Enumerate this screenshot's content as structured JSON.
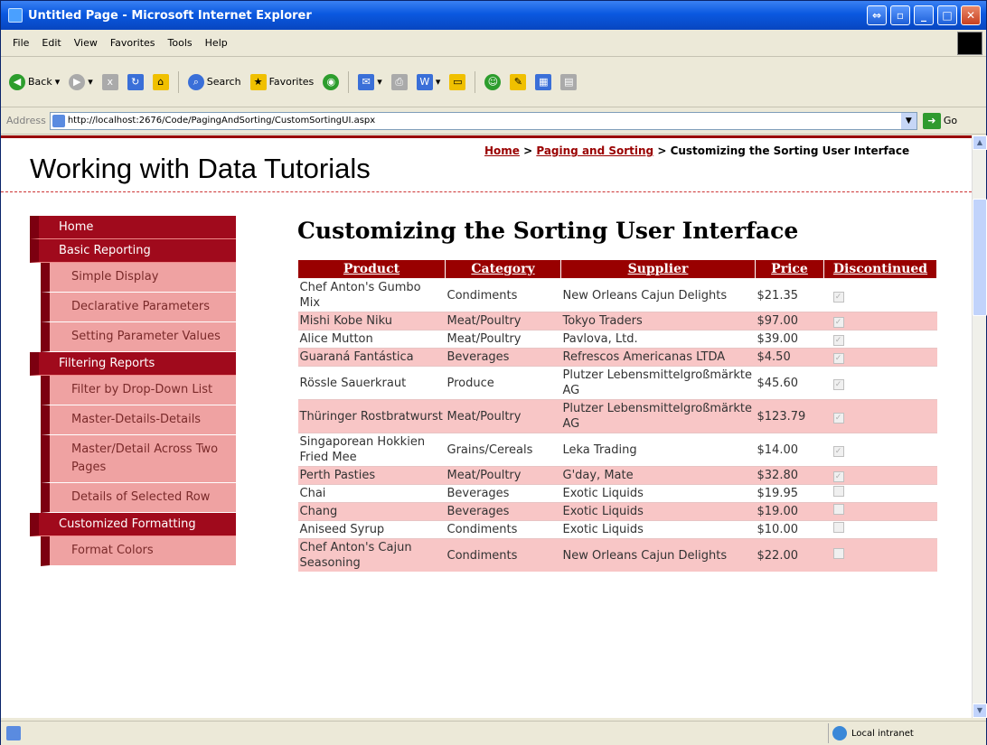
{
  "window": {
    "title": "Untitled Page - Microsoft Internet Explorer"
  },
  "menu": [
    "File",
    "Edit",
    "View",
    "Favorites",
    "Tools",
    "Help"
  ],
  "toolbar": {
    "back": "Back",
    "search": "Search",
    "favorites": "Favorites"
  },
  "address": {
    "label": "Address",
    "url": "http://localhost:2676/Code/PagingAndSorting/CustomSortingUI.aspx",
    "go": "Go"
  },
  "page": {
    "site_title": "Working with Data Tutorials",
    "breadcrumb": {
      "home": "Home",
      "sep1": " > ",
      "section": "Paging and Sorting",
      "sep2": " > ",
      "current": "Customizing the Sorting User Interface"
    },
    "heading": "Customizing the Sorting User Interface"
  },
  "sidebar": [
    {
      "type": "cat",
      "label": "Home"
    },
    {
      "type": "cat",
      "label": "Basic Reporting"
    },
    {
      "type": "sub",
      "label": "Simple Display"
    },
    {
      "type": "sub",
      "label": "Declarative Parameters"
    },
    {
      "type": "sub",
      "label": "Setting Parameter Values"
    },
    {
      "type": "cat",
      "label": "Filtering Reports"
    },
    {
      "type": "sub",
      "label": "Filter by Drop-Down List"
    },
    {
      "type": "sub",
      "label": "Master-Details-Details"
    },
    {
      "type": "sub",
      "label": "Master/Detail Across Two Pages"
    },
    {
      "type": "sub",
      "label": "Details of Selected Row"
    },
    {
      "type": "cat",
      "label": "Customized Formatting"
    },
    {
      "type": "sub",
      "label": "Format Colors"
    }
  ],
  "grid": {
    "headers": [
      "Product",
      "Category",
      "Supplier",
      "Price",
      "Discontinued"
    ],
    "rows": [
      {
        "product": "Chef Anton's Gumbo Mix",
        "category": "Condiments",
        "supplier": "New Orleans Cajun Delights",
        "price": "$21.35",
        "discontinued": true
      },
      {
        "product": "Mishi Kobe Niku",
        "category": "Meat/Poultry",
        "supplier": "Tokyo Traders",
        "price": "$97.00",
        "discontinued": true
      },
      {
        "product": "Alice Mutton",
        "category": "Meat/Poultry",
        "supplier": "Pavlova, Ltd.",
        "price": "$39.00",
        "discontinued": true
      },
      {
        "product": "Guaraná Fantástica",
        "category": "Beverages",
        "supplier": "Refrescos Americanas LTDA",
        "price": "$4.50",
        "discontinued": true
      },
      {
        "product": "Rössle Sauerkraut",
        "category": "Produce",
        "supplier": "Plutzer Lebensmittelgroßmärkte AG",
        "price": "$45.60",
        "discontinued": true
      },
      {
        "product": "Thüringer Rostbratwurst",
        "category": "Meat/Poultry",
        "supplier": "Plutzer Lebensmittelgroßmärkte AG",
        "price": "$123.79",
        "discontinued": true
      },
      {
        "product": "Singaporean Hokkien Fried Mee",
        "category": "Grains/Cereals",
        "supplier": "Leka Trading",
        "price": "$14.00",
        "discontinued": true
      },
      {
        "product": "Perth Pasties",
        "category": "Meat/Poultry",
        "supplier": "G'day, Mate",
        "price": "$32.80",
        "discontinued": true
      },
      {
        "product": "Chai",
        "category": "Beverages",
        "supplier": "Exotic Liquids",
        "price": "$19.95",
        "discontinued": false
      },
      {
        "product": "Chang",
        "category": "Beverages",
        "supplier": "Exotic Liquids",
        "price": "$19.00",
        "discontinued": false
      },
      {
        "product": "Aniseed Syrup",
        "category": "Condiments",
        "supplier": "Exotic Liquids",
        "price": "$10.00",
        "discontinued": false
      },
      {
        "product": "Chef Anton's Cajun Seasoning",
        "category": "Condiments",
        "supplier": "New Orleans Cajun Delights",
        "price": "$22.00",
        "discontinued": false
      }
    ]
  },
  "status": {
    "zone": "Local intranet"
  },
  "colors": {
    "header_red": "#990000",
    "sidebar_cat": "#a00a1c",
    "sidebar_sub": "#efa2a2",
    "alt_row": "#f8c6c6"
  }
}
